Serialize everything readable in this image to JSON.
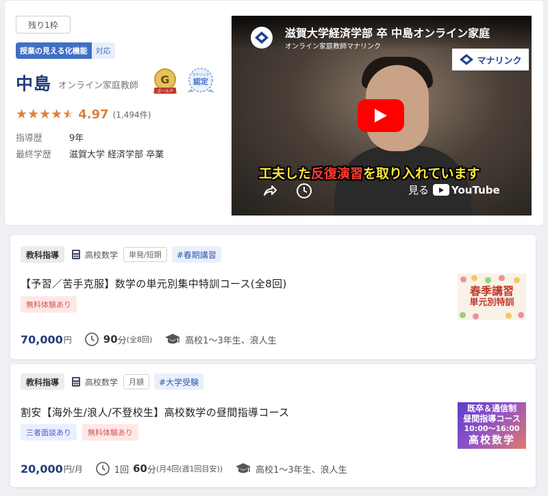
{
  "profile": {
    "slots_badge": "残り1枠",
    "feature_tag": {
      "main": "授業の見える化機能",
      "sub": "対応"
    },
    "name": "中島",
    "role": "オンライン家庭教師",
    "gold_badge": {
      "letter": "G",
      "caption": "ゴールド"
    },
    "cert_badge": {
      "top": "マナリンク",
      "main": "認定"
    },
    "rating": {
      "score": "4.97",
      "count": "(1,494件)",
      "stars": 4.5
    },
    "experience": {
      "label": "指導歴",
      "value": "9年"
    },
    "education": {
      "label": "最終学歴",
      "value": "滋賀大学 経済学部 卒業"
    }
  },
  "video": {
    "title": "滋賀大学経済学部 卒 中島オンライン家庭",
    "subtitle": "オンライン家庭教師マナリンク",
    "brand": "マナリンク",
    "caption": {
      "part1": "工夫した",
      "part2": "反復演習",
      "part3": "を取り入れています"
    },
    "watch_on": "見る",
    "youtube": "YouTube"
  },
  "courses": [
    {
      "category": "教科指導",
      "subject": "高校数学",
      "type": "単発/短期",
      "hashtag": "#春期講習",
      "title": "【予習／苦手克服】数学の単元別集中特訓コース(全8回)",
      "benefits": [
        "無料体験あり"
      ],
      "price": "70,000",
      "price_unit": "円",
      "duration": "90",
      "duration_unit": "分",
      "duration_note": "(全8回)",
      "target": "高校1〜3年生、浪人生",
      "thumb": {
        "line1": "春季講習",
        "line2": "単元別特訓"
      }
    },
    {
      "category": "教科指導",
      "subject": "高校数学",
      "type": "月額",
      "hashtag": "#大学受験",
      "title": "割安【海外生/浪人/不登校生】高校数学の昼間指導コース",
      "benefits": [
        "三者面談あり",
        "無料体験あり"
      ],
      "price": "20,000",
      "price_unit": "円/月",
      "lesson_count": "1回",
      "duration": "60",
      "duration_unit": "分",
      "duration_note": "(月4回(週1回目安))",
      "target": "高校1〜3年生、浪人生",
      "thumb": {
        "line1": "既卒＆通信制",
        "line2": "昼間指導コース",
        "line3": "10:00〜16:00",
        "line4": "高校数学"
      }
    }
  ],
  "colors": {
    "navy": "#223d7a",
    "star": "#e0803a",
    "feature_blue": "#3f6fc6",
    "youtube_red": "#ff0000"
  }
}
